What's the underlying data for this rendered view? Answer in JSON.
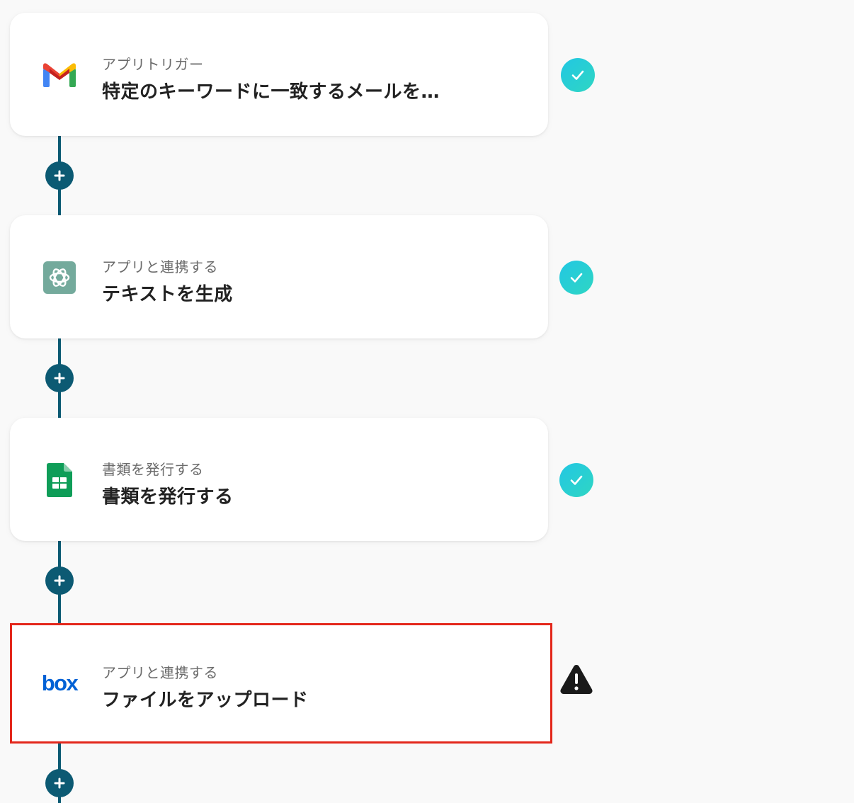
{
  "steps": [
    {
      "kind": "アプリトリガー",
      "title": "特定のキーワードに一致するメールを…",
      "app_icon": "gmail-icon",
      "status": "complete"
    },
    {
      "kind": "アプリと連携する",
      "title": "テキストを生成",
      "app_icon": "chatgpt-icon",
      "status": "complete"
    },
    {
      "kind": "書類を発行する",
      "title": "書類を発行する",
      "app_icon": "google-sheets-icon",
      "status": "complete"
    },
    {
      "kind": "アプリと連携する",
      "title": "ファイルをアップロード",
      "app_icon": "box-icon",
      "status": "warning",
      "selected": true
    }
  ],
  "box_logo_text": "box",
  "colors": {
    "flow_line": "#0c5a73",
    "check_gradient_start": "#22c7e3",
    "check_gradient_end": "#2fd6c3",
    "selected_border": "#e3271b",
    "warning": "#1a1a1a"
  }
}
